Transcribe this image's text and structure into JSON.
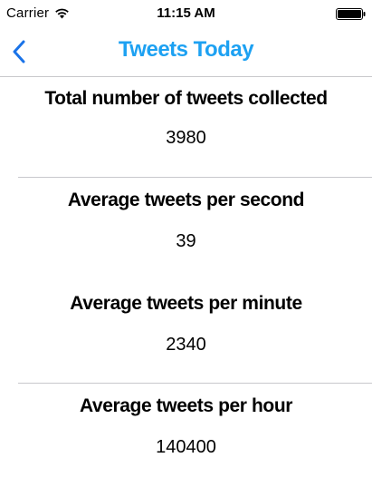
{
  "status_bar": {
    "carrier": "Carrier",
    "time": "11:15 AM",
    "wifi_icon": "wifi-icon",
    "battery_icon": "battery-icon"
  },
  "nav": {
    "title": "Tweets Today",
    "back_icon": "chevron-left-icon"
  },
  "colors": {
    "accent": "#1da1f2",
    "back_button": "#1a73e8",
    "divider": "#c8c8cc",
    "text": "#000000"
  },
  "stats": [
    {
      "label": "Total number of tweets collected",
      "value": "3980"
    },
    {
      "label": "Average tweets per second",
      "value": "39"
    },
    {
      "label": "Average tweets per minute",
      "value": "2340"
    },
    {
      "label": "Average tweets per hour",
      "value": "140400"
    }
  ]
}
